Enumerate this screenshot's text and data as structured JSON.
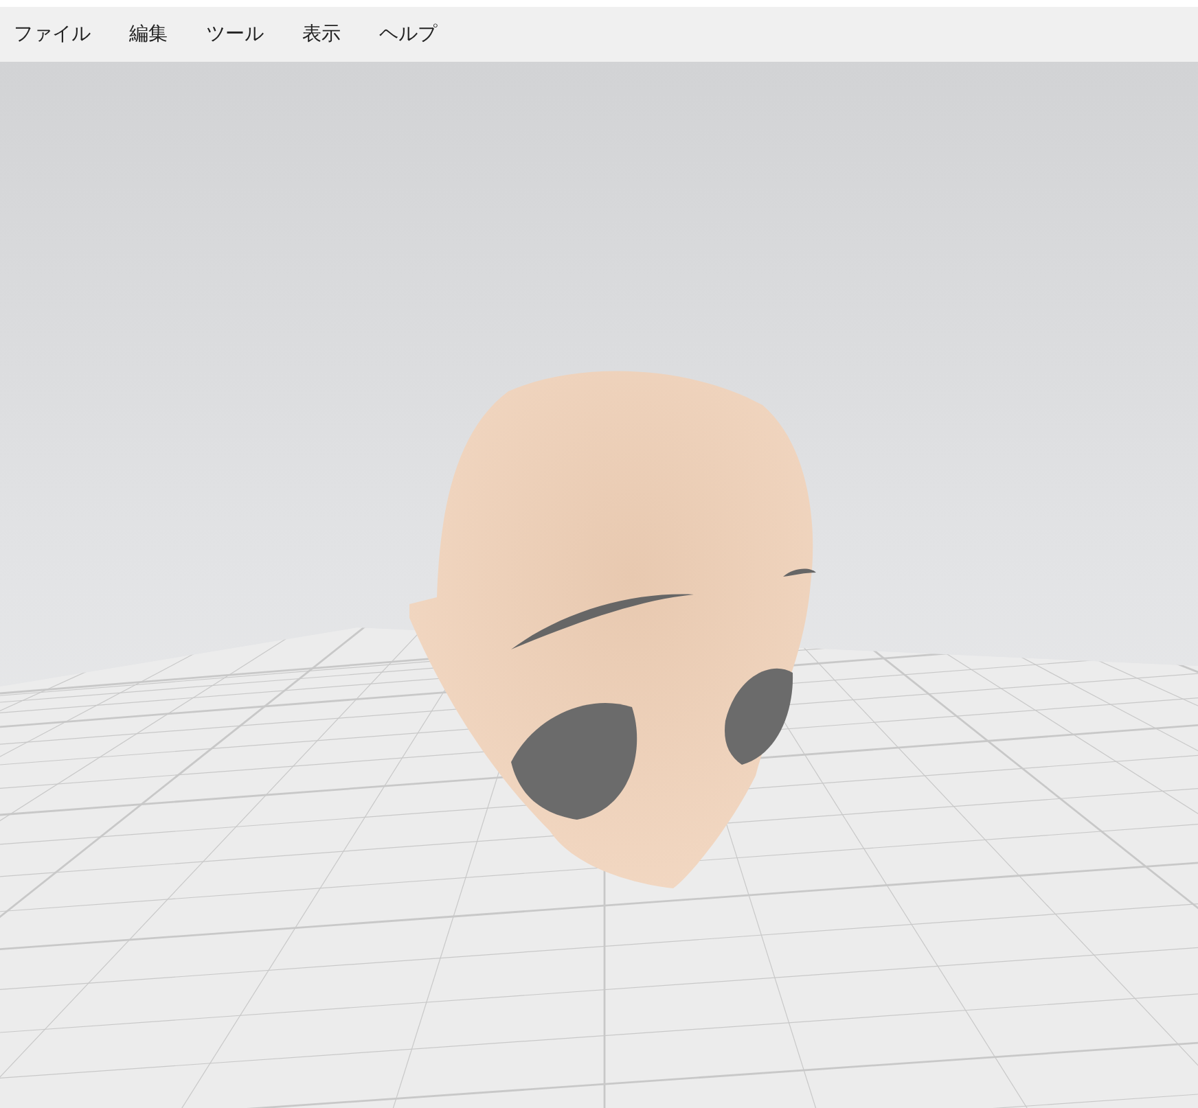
{
  "menu_bar": {
    "items": [
      {
        "label": "ファイル"
      },
      {
        "label": "編集"
      },
      {
        "label": "ツール"
      },
      {
        "label": "表示"
      },
      {
        "label": "ヘルプ"
      }
    ]
  }
}
